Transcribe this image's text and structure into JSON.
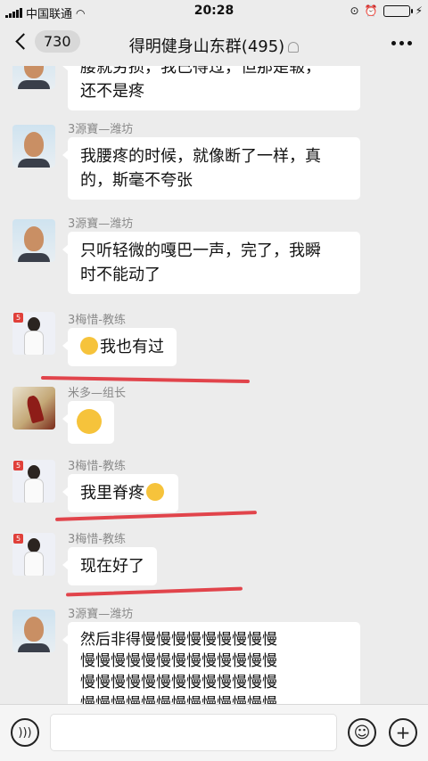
{
  "status_bar": {
    "carrier": "中国联通",
    "time": "20:28"
  },
  "nav": {
    "back_count": "730",
    "title": "得明健身山东群(495)"
  },
  "messages": [
    {
      "sender": "",
      "avatar": "man",
      "lines": [
        "腰就劳损，我已得过，但那是皲，",
        "还不是疼"
      ]
    },
    {
      "sender": "3源寶—潍坊",
      "avatar": "man",
      "lines": [
        "我腰疼的时候，就像断了一样，真",
        "的，斯毫不夸张"
      ]
    },
    {
      "sender": "3源寶—潍坊",
      "avatar": "man",
      "lines": [
        "只听轻微的嘎巴一声，完了，我瞬",
        "时不能动了"
      ]
    },
    {
      "sender": "3梅惜-教练",
      "avatar": "coach",
      "text": "我也有过",
      "emoji": "laugh-cry-emoji",
      "emoji_position": "before"
    },
    {
      "sender": "米多—组长",
      "avatar": "art",
      "text": "",
      "emoji": "surprised-emoji"
    },
    {
      "sender": "3梅惜-教练",
      "avatar": "coach",
      "text": "我里脊疼",
      "emoji": "laugh-cry-emoji",
      "emoji_position": "after"
    },
    {
      "sender": "3梅惜-教练",
      "avatar": "coach",
      "text": "现在好了"
    },
    {
      "sender": "3源寶—潍坊",
      "avatar": "man",
      "lines": [
        "然后非得慢慢慢慢慢慢慢慢慢",
        "慢慢慢慢慢慢慢慢慢慢慢慢慢",
        "慢慢慢慢慢慢慢慢慢慢慢慢慢",
        "慢慢慢慢慢慢慢慢慢慢慢慢慢"
      ]
    }
  ],
  "input_bar": {
    "voice_icon": "voice-icon",
    "emoji_icon": "emoji-icon",
    "plus_icon": "plus-icon"
  },
  "colors": {
    "background": "#ececec",
    "annotation_red": "#e0323a",
    "battery_green": "#2ecc40"
  }
}
